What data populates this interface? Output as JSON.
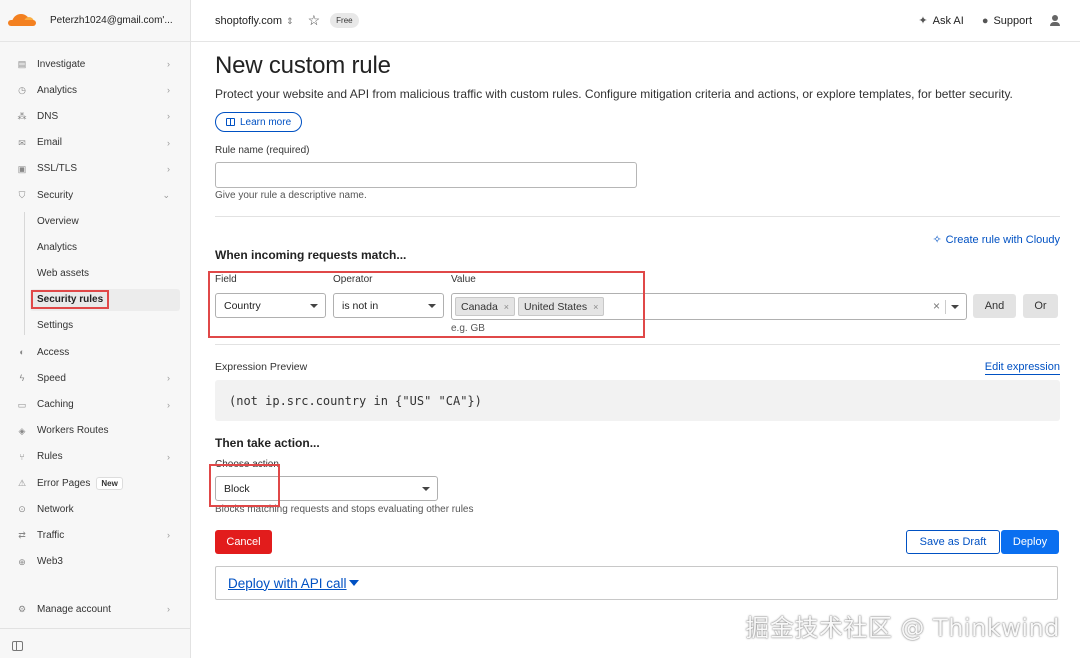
{
  "account": {
    "email": "Peterzh1024@gmail.com'..."
  },
  "topbar": {
    "domain": "shoptofly.com",
    "plan_badge": "Free",
    "ask_ai": "Ask AI",
    "support": "Support"
  },
  "sidebar": {
    "items": [
      {
        "label": "Investigate",
        "icon": "document-icon"
      },
      {
        "label": "Analytics",
        "icon": "clock-icon"
      },
      {
        "label": "DNS",
        "icon": "network-icon"
      },
      {
        "label": "Email",
        "icon": "mail-icon"
      },
      {
        "label": "SSL/TLS",
        "icon": "lock-icon"
      },
      {
        "label": "Security",
        "icon": "shield-icon"
      }
    ],
    "security_sub": [
      "Overview",
      "Analytics",
      "Web assets",
      "Security rules",
      "Settings"
    ],
    "items_after": [
      {
        "label": "Access",
        "icon": "access-icon"
      },
      {
        "label": "Speed",
        "icon": "bolt-icon"
      },
      {
        "label": "Caching",
        "icon": "server-icon"
      },
      {
        "label": "Workers Routes",
        "icon": "workers-icon"
      },
      {
        "label": "Rules",
        "icon": "fork-icon"
      },
      {
        "label": "Error Pages",
        "icon": "warning-icon",
        "badge": "New"
      },
      {
        "label": "Network",
        "icon": "pin-icon"
      },
      {
        "label": "Traffic",
        "icon": "traffic-icon"
      },
      {
        "label": "Web3",
        "icon": "globe-icon"
      }
    ],
    "manage_account": "Manage account"
  },
  "page": {
    "title": "New custom rule",
    "description": "Protect your website and API from malicious traffic with custom rules. Configure mitigation criteria and actions, or explore templates, for better security.",
    "learn_more": "Learn more",
    "rule_name_label": "Rule name (required)",
    "rule_name_value": "",
    "rule_name_hint": "Give your rule a descriptive name.",
    "match_heading": "When incoming requests match...",
    "cloudy_link": "Create rule with Cloudy",
    "field_label": "Field",
    "operator_label": "Operator",
    "value_label": "Value",
    "field_value": "Country",
    "operator_value": "is not in",
    "value_chips": [
      "Canada",
      "United States"
    ],
    "value_hint": "e.g. GB",
    "and_button": "And",
    "or_button": "Or",
    "expression_label": "Expression Preview",
    "edit_expression": "Edit expression",
    "expression": "(not ip.src.country in {\"US\" \"CA\"})",
    "action_heading": "Then take action...",
    "choose_action_label": "Choose action",
    "action_value": "Block",
    "action_hint": "Blocks matching requests and stops evaluating other rules",
    "cancel": "Cancel",
    "save_draft": "Save as Draft",
    "deploy": "Deploy",
    "api_call": "Deploy with API call"
  },
  "watermark": "掘金技术社区 @ Thinkwind",
  "colors": {
    "accent": "#0051c3",
    "danger": "#e21c1c",
    "highlight": "#e04848",
    "brand": "#f38020"
  }
}
